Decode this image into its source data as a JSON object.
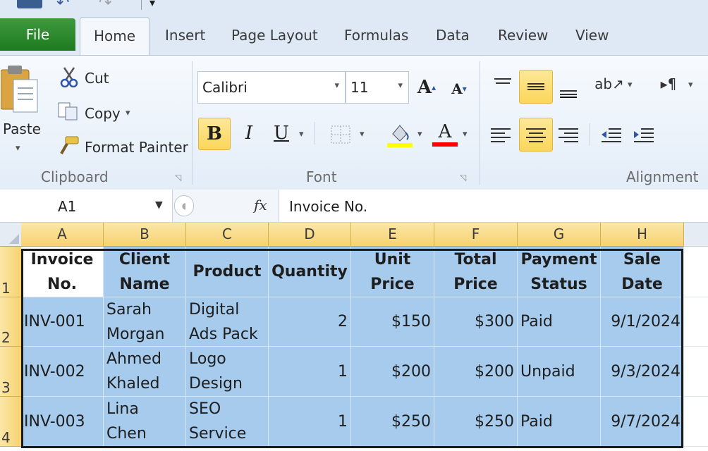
{
  "quick_access": {
    "icons": [
      "save-icon",
      "undo-icon",
      "redo-icon",
      "customize-icon"
    ],
    "undo_glyph": "↶",
    "redo_glyph": "↷",
    "drop_glyph": "▾"
  },
  "tabs": [
    {
      "id": "file",
      "label": "File"
    },
    {
      "id": "home",
      "label": "Home"
    },
    {
      "id": "insert",
      "label": "Insert"
    },
    {
      "id": "page-layout",
      "label": "Page Layout"
    },
    {
      "id": "formulas",
      "label": "Formulas"
    },
    {
      "id": "data",
      "label": "Data"
    },
    {
      "id": "review",
      "label": "Review"
    },
    {
      "id": "view",
      "label": "View"
    }
  ],
  "ribbon": {
    "clipboard": {
      "group_label": "Clipboard",
      "paste_label": "Paste",
      "cut_label": "Cut",
      "copy_label": "Copy",
      "format_painter_label": "Format Painter"
    },
    "font": {
      "group_label": "Font",
      "font_name": "Calibri",
      "font_size": "11",
      "bold": "B",
      "italic": "I",
      "underline": "U",
      "grow_glyph": "A",
      "shrink_glyph": "A",
      "font_color_glyph": "A",
      "fill_color": "#ffff00",
      "font_color": "#ff0000"
    },
    "alignment": {
      "group_label": "Alignment"
    }
  },
  "formula_bar": {
    "name_box": "A1",
    "fx": "fx",
    "content": "Invoice No."
  },
  "sheet": {
    "columns": [
      "A",
      "B",
      "C",
      "D",
      "E",
      "F",
      "G",
      "H"
    ],
    "rows": [
      "1",
      "2",
      "3",
      "4"
    ],
    "header": [
      [
        "Invoice",
        "No."
      ],
      [
        "Client",
        "Name"
      ],
      [
        "Product"
      ],
      [
        "Quantity"
      ],
      [
        "Unit Price"
      ],
      [
        "Total",
        "Price"
      ],
      [
        "Payment",
        "Status"
      ],
      [
        "Sale Date"
      ]
    ],
    "data": [
      [
        [
          "INV-001"
        ],
        [
          "Sarah",
          "Morgan"
        ],
        [
          "Digital",
          "Ads Pack"
        ],
        [
          "2"
        ],
        [
          "$150"
        ],
        [
          "$300"
        ],
        [
          "Paid"
        ],
        [
          "9/1/2024"
        ]
      ],
      [
        [
          "INV-002"
        ],
        [
          "Ahmed",
          "Khaled"
        ],
        [
          "Logo",
          "Design"
        ],
        [
          "1"
        ],
        [
          "$200"
        ],
        [
          "$200"
        ],
        [
          "Unpaid"
        ],
        [
          "9/3/2024"
        ]
      ],
      [
        [
          "INV-003"
        ],
        [
          "Lina Chen"
        ],
        [
          "SEO",
          "Service"
        ],
        [
          "1"
        ],
        [
          "$250"
        ],
        [
          "$250"
        ],
        [
          "Paid"
        ],
        [
          "9/7/2024"
        ]
      ]
    ],
    "numeric_columns": [
      3,
      4,
      5,
      7
    ],
    "selection_color": "#a6cbed",
    "header_color": "#f7d271"
  }
}
